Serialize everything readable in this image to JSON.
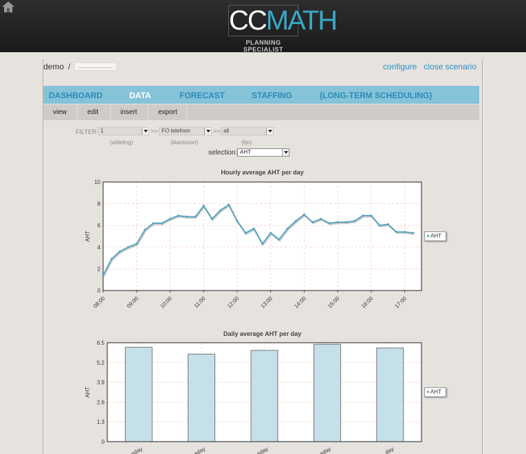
{
  "header": {
    "logo_cc": "CC",
    "logo_math": "MATH",
    "logo_sub": "PLANNING SPECIALIST"
  },
  "breadcrumb": {
    "root": "demo",
    "separator": "/"
  },
  "top_links": {
    "configure": "configure",
    "close_scenario": "close scenario"
  },
  "main_nav": [
    {
      "label": "DASHBOARD",
      "active": false
    },
    {
      "label": "DATA",
      "active": true
    },
    {
      "label": "FORECAST",
      "active": false
    },
    {
      "label": "STAFFING",
      "active": false
    },
    {
      "label": "(LONG-TERM SCHEDULING)",
      "active": false
    }
  ],
  "sub_nav": [
    "view",
    "edit",
    "insert",
    "export"
  ],
  "filters": {
    "label": "FILTER",
    "afdeling": {
      "value": "1",
      "caption": "(afdeling)"
    },
    "klantsoort": {
      "value": "FO telefoon",
      "caption": "(klantsoort)"
    },
    "lijn": {
      "value": "all",
      "caption": "(lijn)"
    },
    "chevrons": ">>",
    "selection_label": "selection:",
    "selection_value": "AHT"
  },
  "colors": {
    "line": "#5aa5c0",
    "bar": "#c6e0e9",
    "grid": "#f0b8b8",
    "nav": "#86c3d9"
  },
  "chart_data": [
    {
      "type": "line",
      "title": "Hourly average AHT per day",
      "ylabel": "AHT",
      "ylim": [
        0,
        10
      ],
      "yticks": [
        "0",
        "2",
        "4",
        "6",
        "8",
        "10"
      ],
      "xlim": [
        8.0,
        17.5
      ],
      "xticks": [
        "08:00",
        "09:00",
        "10:00",
        "11:00",
        "12:00",
        "13:00",
        "14:00",
        "15:00",
        "16:00",
        "17:00"
      ],
      "legend": "AHT",
      "legend_position": "right",
      "series": [
        {
          "name": "AHT",
          "x": [
            8.0,
            8.25,
            8.5,
            8.75,
            9.0,
            9.25,
            9.5,
            9.75,
            10.0,
            10.25,
            10.5,
            10.75,
            11.0,
            11.25,
            11.5,
            11.75,
            12.0,
            12.25,
            12.5,
            12.75,
            13.0,
            13.25,
            13.5,
            13.75,
            14.0,
            14.25,
            14.5,
            14.75,
            15.0,
            15.25,
            15.5,
            15.75,
            16.0,
            16.25,
            16.5,
            16.75,
            17.0,
            17.25
          ],
          "y": [
            1.4,
            2.9,
            3.6,
            4.0,
            4.3,
            5.6,
            6.2,
            6.2,
            6.6,
            6.9,
            6.8,
            6.8,
            7.8,
            6.6,
            7.4,
            7.9,
            6.4,
            5.3,
            5.7,
            4.3,
            5.3,
            4.7,
            5.7,
            6.4,
            7.0,
            6.3,
            6.6,
            6.2,
            6.3,
            6.3,
            6.4,
            6.9,
            6.9,
            6.0,
            6.1,
            5.4,
            5.4,
            5.3
          ]
        }
      ]
    },
    {
      "type": "bar",
      "title": "Daily average AHT per day",
      "ylabel": "AHT",
      "ylim": [
        0,
        6.5
      ],
      "yticks": [
        "0",
        "1.3",
        "2.6",
        "3.9",
        "5.2",
        "6.5"
      ],
      "categories": [
        "Monday",
        "Tuesday",
        "Wednesday",
        "Thursday",
        "Friday"
      ],
      "category_labels_visible": [
        "nday",
        "sday",
        "sday",
        "sday",
        "day"
      ],
      "legend": "AHT",
      "legend_position": "right",
      "series": [
        {
          "name": "AHT",
          "values": [
            6.2,
            5.75,
            6.0,
            6.4,
            6.15
          ]
        }
      ]
    }
  ]
}
